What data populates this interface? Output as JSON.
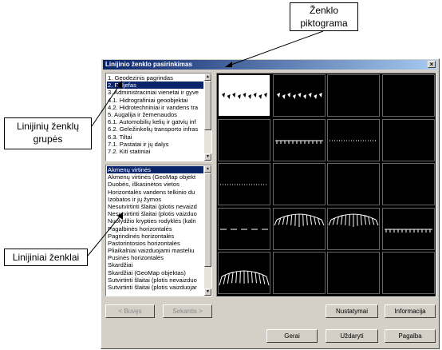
{
  "annotations": {
    "symbol_icon": "Ženklo piktograma",
    "line_groups": "Linijinių ženklų grupės",
    "line_symbols": "Linijiniai ženklai"
  },
  "dialog": {
    "title": "Linijinio ženklo pasirinkimas",
    "close_label": "×",
    "groups": [
      "1. Geodezinis pagrindas",
      "2. Reljefas",
      "3. Administraciniai vienetai ir gyve",
      "4.1. Hidrografiniai geoobjektai",
      "4.2. Hidrotechniniai ir vandens tra",
      "5. Augalija ir žemenaudos",
      "6.1. Automobilių kelių ir gatvių inf",
      "6.2. Geležinkelių transporto infras",
      "6.3. Tiltai",
      "7.1. Pastatai ir jų dalys",
      "7.2. Kiti statiniai"
    ],
    "selected_group": 1,
    "lines": [
      "Akmenų virtinės",
      "Akmenų virtinės (GeoMap objekt",
      "Duobės, iškasinėtos vietos",
      "Horizontalės vandens telkinio du",
      "Izobatos ir jų žymos",
      "Nesutvirtinti šlaitai (plotis nevaizd",
      "Nesutvirtinti šlaitai (plotis vaizduo",
      "Nuolydžio krypties rodyklės (kaln",
      "Pagalbinės horizontalės",
      "Pagrindinės horizontalės",
      "Pastorintosios horizontalės",
      "Pliaikalniai vaizduojami masteliu",
      "Pusinės horizontalės",
      "Skardžiai",
      "Skardžiai (GeoMap objektas)",
      "Sutvirtinti šlaitai (plotis nevaizduo",
      "Sutvirtinti šlaitai (plotis vaizduojar"
    ],
    "selected_line": 0,
    "buttons": {
      "prev": "< Buvęs",
      "next": "Sekantis >",
      "settings": "Nustatymai",
      "info": "Informacija",
      "ok": "Gerai",
      "close": "Uždaryti",
      "help": "Pagalba"
    },
    "preview_grid": {
      "rows": 5,
      "cols": 4,
      "selected_cell": 0,
      "symbols": [
        "stone-chain",
        "stone-chain",
        "empty",
        "empty",
        "empty",
        "tick-line",
        "dotted-line",
        "empty",
        "dotted-line",
        "empty",
        "empty",
        "empty",
        "dashed-line",
        "slope-arc",
        "slope-arc",
        "tick-line",
        "slope-arc-wide",
        "empty",
        "empty",
        "empty"
      ]
    }
  }
}
